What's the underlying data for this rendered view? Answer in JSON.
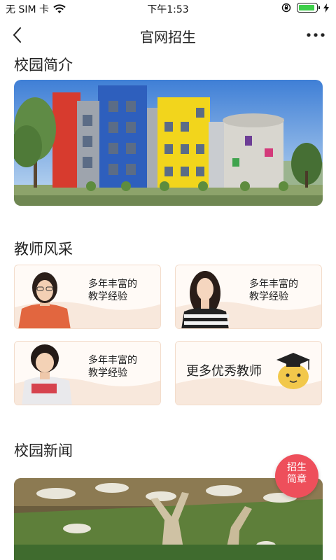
{
  "status_bar": {
    "carrier": "无 SIM 卡",
    "time": "下午1:53"
  },
  "nav": {
    "title": "官网招生"
  },
  "sections": {
    "intro_title": "校园简介",
    "teachers_title": "教师风采",
    "news_title": "校园新闻"
  },
  "teachers": {
    "cards": [
      {
        "caption_line1": "多年丰富的",
        "caption_line2": "教学经验"
      },
      {
        "caption_line1": "多年丰富的",
        "caption_line2": "教学经验"
      },
      {
        "caption_line1": "多年丰富的",
        "caption_line2": "教学经验"
      }
    ],
    "more_label": "更多优秀教师"
  },
  "badge": {
    "line1": "招生",
    "line2": "简章"
  },
  "colors": {
    "badge": "#ee4f5b",
    "card_border": "#f3dccb",
    "battery": "#3ecf4a"
  },
  "icons": {
    "wifi": "wifi-icon",
    "lock_rotation": "rotation-lock-icon",
    "charging": "charging-icon",
    "back": "chevron-left-icon",
    "more": "more-dots-icon",
    "mascot": "graduation-mascot-icon"
  }
}
